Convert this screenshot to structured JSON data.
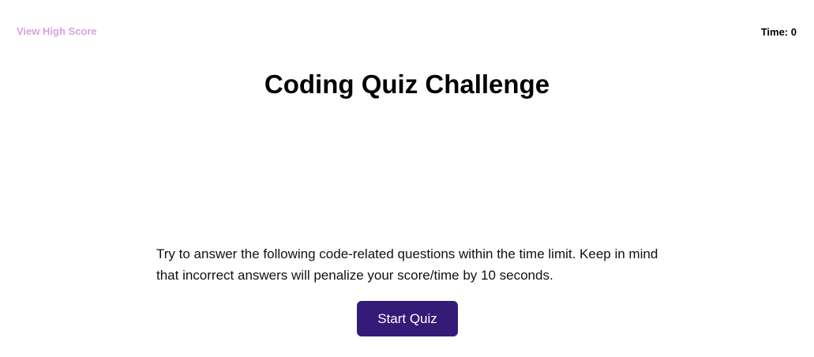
{
  "header": {
    "high_score_label": "View High Score",
    "timer_label": "Time: ",
    "timer_value": "0"
  },
  "main": {
    "title": "Coding Quiz Challenge",
    "instructions": "Try to answer the following code-related questions within the time limit. Keep in mind that incorrect answers will penalize your score/time by 10 seconds.",
    "start_button_label": "Start Quiz"
  },
  "colors": {
    "link": "#d8a1e6",
    "button_background": "#351b78",
    "button_text": "#ffffff",
    "page_background": "#ffffff"
  }
}
